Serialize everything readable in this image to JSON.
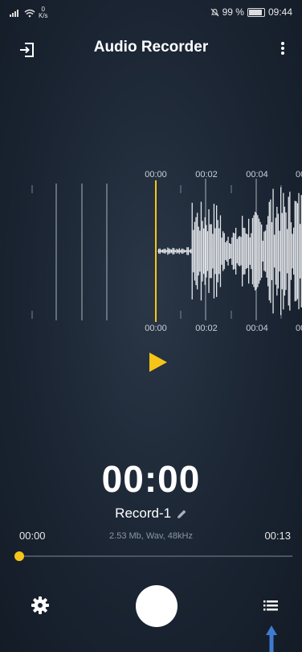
{
  "status_bar": {
    "speed_value": "0",
    "speed_unit": "K/s",
    "battery_text": "99 %",
    "battery_level": 0.99,
    "time": "09:44"
  },
  "app_bar": {
    "title": "Audio Recorder",
    "exit_icon": "exit-icon",
    "menu_icon": "more-vertical-icon"
  },
  "waveform": {
    "time_marks": [
      "00:00",
      "00:02",
      "00:04",
      "00"
    ],
    "playhead_color": "#f5c518"
  },
  "player": {
    "play_icon": "play-icon",
    "timer": "00:00",
    "record_name": "Record-1",
    "edit_icon": "pencil-icon",
    "meta": "2.53 Mb, Wav, 48kHz",
    "time_start": "00:00",
    "time_end": "00:13",
    "seek_position": 0
  },
  "bottom_bar": {
    "settings_icon": "gear-icon",
    "record_button": "record-button",
    "list_icon": "list-icon",
    "accent_color": "#f5c518",
    "arrow_color": "#3f7bd1"
  }
}
